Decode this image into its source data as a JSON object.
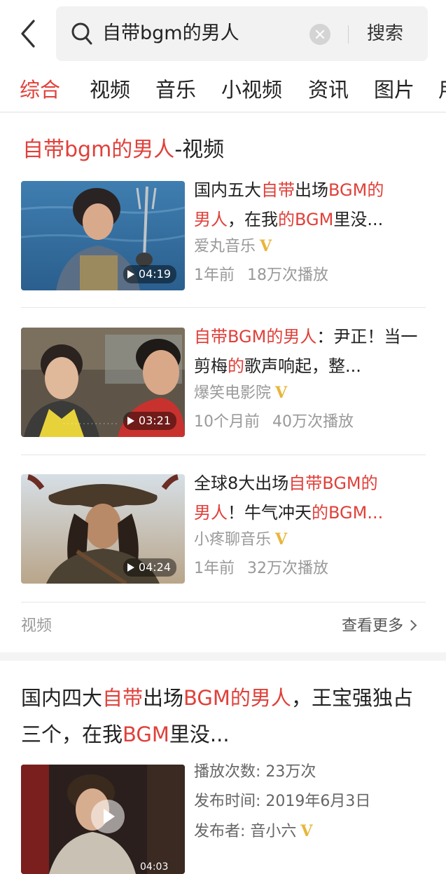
{
  "search": {
    "query": "自带bgm的男人",
    "button": "搜索"
  },
  "tabs": [
    "综合",
    "视频",
    "音乐",
    "小视频",
    "资讯",
    "图片",
    "用"
  ],
  "video_section": {
    "title_query": "自带bgm的男人",
    "title_suffix": "-视频",
    "items": [
      {
        "title": [
          {
            "t": "国内五大",
            "h": false
          },
          {
            "t": "自带",
            "h": true
          },
          {
            "t": "出场",
            "h": false
          },
          {
            "t": "BGM的",
            "h": true
          },
          {
            "t": "男人",
            "h": true
          },
          {
            "t": "，在我",
            "h": false
          },
          {
            "t": "的BGM",
            "h": true
          },
          {
            "t": "里没...",
            "h": false
          }
        ],
        "author": "爱丸音乐",
        "time": "1年前",
        "plays": "18万次播放",
        "duration": "04:19"
      },
      {
        "title": [
          {
            "t": "自带BGM的男人",
            "h": true
          },
          {
            "t": "：尹正！当一剪梅",
            "h": false
          },
          {
            "t": "的",
            "h": true
          },
          {
            "t": "歌声响起，整...",
            "h": false
          }
        ],
        "author": "爆笑电影院",
        "time": "10个月前",
        "plays": "40万次播放",
        "duration": "03:21"
      },
      {
        "title": [
          {
            "t": "全球8大出场",
            "h": false
          },
          {
            "t": "自带BGM的",
            "h": true
          },
          {
            "t": "男人",
            "h": true
          },
          {
            "t": "！牛气冲天",
            "h": false
          },
          {
            "t": "的BGM...",
            "h": true
          }
        ],
        "author": "小疼聊音乐",
        "time": "1年前",
        "plays": "32万次播放",
        "duration": "04:24"
      }
    ],
    "footer_label": "视频",
    "more_label": "查看更多"
  },
  "result2": {
    "title": [
      {
        "t": "国内四大",
        "h": false
      },
      {
        "t": "自带",
        "h": true
      },
      {
        "t": "出场",
        "h": false
      },
      {
        "t": "BGM的男人",
        "h": true
      },
      {
        "t": "，王宝强独占三个，在我",
        "h": false
      },
      {
        "t": "BGM",
        "h": true
      },
      {
        "t": "里没...",
        "h": false
      }
    ],
    "plays_label": "播放次数: 23万次",
    "date_label": "发布时间: 2019年6月3日",
    "publisher_label": "发布者: 音小六",
    "duration": "04:03"
  },
  "badge": "V",
  "colors": {
    "accent": "#e0403a",
    "verified": "#e8b63a"
  }
}
